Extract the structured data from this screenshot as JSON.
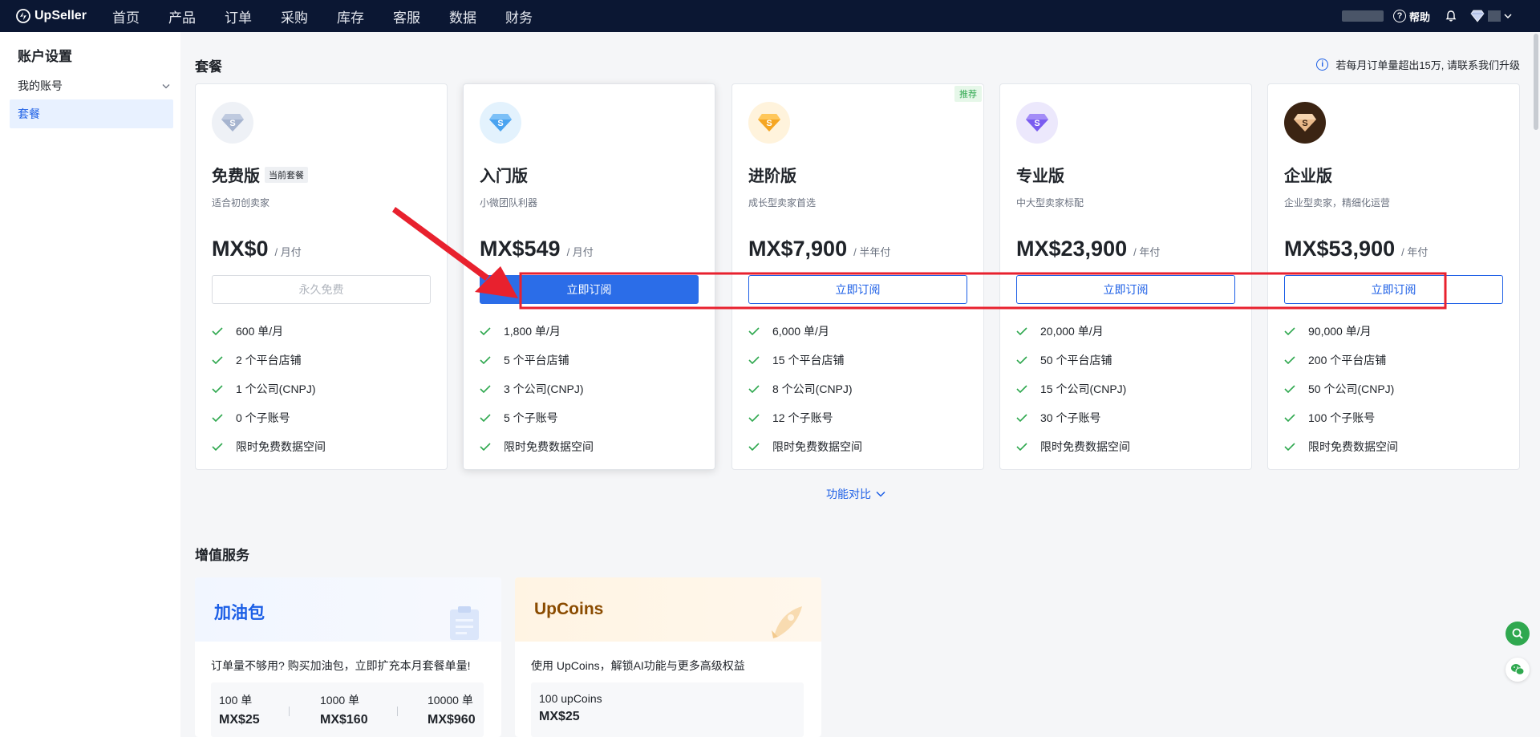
{
  "nav": {
    "logo_text": "UpSeller",
    "items": [
      "首页",
      "产品",
      "订单",
      "采购",
      "库存",
      "客服",
      "数据",
      "财务"
    ],
    "help_label": "帮助"
  },
  "sidebar": {
    "title": "账户设置",
    "account_label": "我的账号",
    "plan_label": "套餐"
  },
  "plans_section": {
    "title": "套餐",
    "upgrade_note": "若每月订单量超出15万, 请联系我们升级",
    "current_tag": "当前套餐",
    "recommend_tag": "推荐",
    "cards": [
      {
        "name": "免费版",
        "desc": "适合初创卖家",
        "price": "MX$0",
        "period": "/ 月付",
        "button": "永久免费",
        "features": [
          "600 单/月",
          "2 个平台店铺",
          "1 个公司(CNPJ)",
          "0 个子账号",
          "限时免费数据空间"
        ]
      },
      {
        "name": "入门版",
        "desc": "小微团队利器",
        "price": "MX$549",
        "period": "/ 月付",
        "button": "立即订阅",
        "features": [
          "1,800 单/月",
          "5 个平台店铺",
          "3 个公司(CNPJ)",
          "5 个子账号",
          "限时免费数据空间"
        ]
      },
      {
        "name": "进阶版",
        "desc": "成长型卖家首选",
        "price": "MX$7,900",
        "period": "/ 半年付",
        "button": "立即订阅",
        "features": [
          "6,000 单/月",
          "15 个平台店铺",
          "8 个公司(CNPJ)",
          "12 个子账号",
          "限时免费数据空间"
        ]
      },
      {
        "name": "专业版",
        "desc": "中大型卖家标配",
        "price": "MX$23,900",
        "period": "/ 年付",
        "button": "立即订阅",
        "features": [
          "20,000 单/月",
          "50 个平台店铺",
          "15 个公司(CNPJ)",
          "30 个子账号",
          "限时免费数据空间"
        ]
      },
      {
        "name": "企业版",
        "desc": "企业型卖家，精细化运营",
        "price": "MX$53,900",
        "period": "/ 年付",
        "button": "立即订阅",
        "features": [
          "90,000 单/月",
          "200 个平台店铺",
          "50 个公司(CNPJ)",
          "100 个子账号",
          "限时免费数据空间"
        ]
      }
    ],
    "compare_label": "功能对比"
  },
  "addons_section": {
    "title": "增值服务",
    "fuel": {
      "title": "加油包",
      "desc": "订单量不够用? 购买加油包，立即扩充本月套餐单量!",
      "options": [
        {
          "qty": "100 单",
          "price": "MX$25"
        },
        {
          "qty": "1000 单",
          "price": "MX$160"
        },
        {
          "qty": "10000 单",
          "price": "MX$960"
        }
      ]
    },
    "upcoins": {
      "title": "UpCoins",
      "desc": "使用 UpCoins，解锁AI功能与更多高级权益",
      "options": [
        {
          "qty": "100 upCoins",
          "price": "MX$25"
        }
      ]
    }
  },
  "colors": {
    "nav_bg": "#0b1733",
    "accent": "#1b5ee6",
    "annotation_red": "#e8212e"
  }
}
